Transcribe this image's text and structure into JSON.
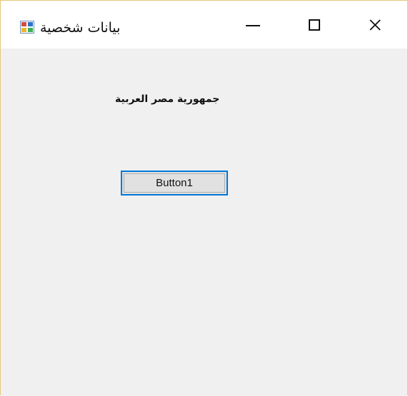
{
  "window": {
    "title": "بيانات شخصية",
    "icon": "windows-form-icon",
    "controls": {
      "minimize_icon": "minimize-icon",
      "maximize_icon": "maximize-icon",
      "close_symbol": "✕"
    }
  },
  "form": {
    "label_text": "جمهورية مصر العربية",
    "button1_text": "Button1"
  },
  "colors": {
    "window_border": "#e5c77a",
    "titlebar_bg": "#ffffff",
    "client_bg": "#f0f0f0",
    "button_focus_border": "#0078d7",
    "button_bg": "#e1e1e1"
  }
}
